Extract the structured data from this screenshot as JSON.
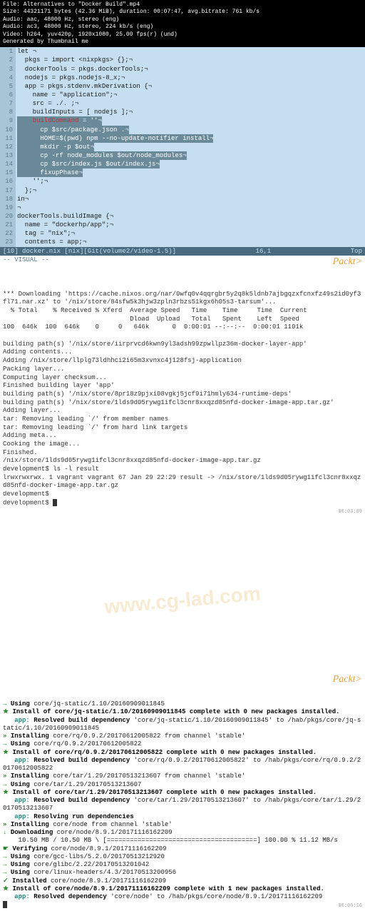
{
  "video_meta": {
    "line1": "File: Alternatives to \"Docker Build\".mp4",
    "line2": "Size: 44321171 bytes (42.36 MiB), duration: 00:07:47, avg.bitrate: 761 kb/s",
    "line3": "Audio: aac, 48000 Hz, stereo (eng)",
    "line4": "Audio: ac3, 48000 Hz, stereo, 224 kb/s (eng)",
    "line5": "Video: h264, yuv420p, 1920x1080, 25.00 fps(r) (und)",
    "line6": "Generated by Thumbnail me"
  },
  "editor": {
    "lines": [
      {
        "n": "1",
        "t": "let ¬"
      },
      {
        "n": "2",
        "t": "  pkgs = import <nixpkgs> {};¬"
      },
      {
        "n": "3",
        "t": "  dockerTools = pkgs.dockerTools;¬"
      },
      {
        "n": "4",
        "t": "  nodejs = pkgs.nodejs-8_x;¬"
      },
      {
        "n": "5",
        "t": "  app = pkgs.stdenv.mkDerivation {¬"
      },
      {
        "n": "6",
        "t": "    name = \"application\";¬"
      },
      {
        "n": "7",
        "t": "    src = ./. ;¬"
      },
      {
        "n": "8",
        "t": "    buildInputs = [ nodejs ];¬"
      },
      {
        "n": "9",
        "t": "    buildCommand = ''¬",
        "sel": true,
        "red": "buildCommand"
      },
      {
        "n": "10",
        "t": "      cp $src/package.json .¬",
        "sel": true
      },
      {
        "n": "11",
        "t": "      HOME=$(pwd) npm --no-update-notifier install¬",
        "sel": true
      },
      {
        "n": "12",
        "t": "      mkdir -p $out¬",
        "sel": true
      },
      {
        "n": "13",
        "t": "      cp -rf node_modules $out/node_modules¬",
        "sel": true
      },
      {
        "n": "14",
        "t": "      cp $src/index.js $out/index.js¬",
        "sel": true
      },
      {
        "n": "15",
        "t": "      fixupPhase¬",
        "sel": true
      },
      {
        "n": "16",
        "t": "    '';¬"
      },
      {
        "n": "17",
        "t": "  };¬"
      },
      {
        "n": "18",
        "t": "in¬"
      },
      {
        "n": "19",
        "t": "¬"
      },
      {
        "n": "20",
        "t": "dockerTools.buildImage {¬"
      },
      {
        "n": "21",
        "t": "  name = \"dockerhp/app\";¬"
      },
      {
        "n": "22",
        "t": "  tag = \"nix\";¬"
      },
      {
        "n": "23",
        "t": "  contents = app;¬"
      }
    ],
    "statusbar_left": "[10] docker.nix [nix][Git(volume2/video-1.5)]",
    "statusbar_mid": "16,1",
    "statusbar_right": "Top",
    "mode": "-- VISUAL --"
  },
  "terminal1": {
    "packt": "Packt>",
    "lines": [
      "",
      "*** Downloading 'https://cache.nixos.org/nar/0wfq0v4qqrgbr5y2q8k5ldnb7ajbgqzxfcnxfz49s2id0yf3fl71.nar.xz' to '/nix/store/84sfw5k3hjw3zpln3rbzs51kgx6h05s3-tarsum'...",
      "  % Total    % Received % Xferd  Average Speed   Time    Time     Time  Current",
      "                                 Dload  Upload   Total   Spent    Left  Speed",
      "100  646k  100  646k    0     0   646k      0  0:00:01 --:--:--  0:00:01 1101k",
      "",
      "building path(s) '/nix/store/iirprvcd6kwn9yl3adsh99zpwllpz36m-docker-layer-app'",
      "Adding contents...",
      "Adding /nix/store/llplg73ldhhci2i65m3xvnxc4j128fsj-application",
      "Packing layer...",
      "Computing layer checksum...",
      "Finished building layer 'app'",
      "building path(s) '/nix/store/8pr18z9pjxi08vgkj5jcf9i71hmly634-runtime-deps'",
      "building path(s) '/nix/store/1lds9d05rywg1ifcl3cnr8xxqzd85nfd-docker-image-app.tar.gz'",
      "Adding layer...",
      "tar: Removing leading `/' from member names",
      "tar: Removing leading `/' from hard link targets",
      "Adding meta...",
      "Cooking the image...",
      "Finished.",
      "/nix/store/1lds9d05rywg1ifcl3cnr8xxqzd85nfd-docker-image-app.tar.gz",
      "development$ ls -l result",
      "lrwxrwxrwx. 1 vagrant vagrant 67 Jan 29 22:29 result -> /nix/store/1lds9d05rywg1ifcl3cnr8xxqzd85nfd-docker-image-app.tar.gz",
      "development$ ",
      "development$ "
    ],
    "timestamp": "00:03:09"
  },
  "watermark": "www.cg-lad.com",
  "hab": {
    "packt": "Packt>",
    "lines": [
      {
        "p": "→ ",
        "a": "Using",
        "t": " core/jq-static/1.10/20160909011845"
      },
      {
        "p": "★ ",
        "a": "Install of core/jq-static/1.10/20160909011845 complete with 0 new packages installed.",
        "t": ""
      },
      {
        "p": "   ",
        "app": "app:",
        "a": " Resolved build dependency",
        "t": " 'core/jq-static/1.10/20160909011845' to /hab/pkgs/core/jq-static/1.10/20160909011845"
      },
      {
        "p": "» ",
        "a": "Installing",
        "t": " core/rq/0.9.2/20170612005822 from channel 'stable'"
      },
      {
        "p": "→ ",
        "a": "Using",
        "t": " core/rq/0.9.2/20170612005822"
      },
      {
        "p": "★ ",
        "a": "Install of core/rq/0.9.2/20170612005822 complete with 0 new packages installed.",
        "t": ""
      },
      {
        "p": "   ",
        "app": "app:",
        "a": " Resolved build dependency",
        "t": " 'core/rq/0.9.2/20170612005822' to /hab/pkgs/core/rq/0.9.2/20170612005822"
      },
      {
        "p": "» ",
        "a": "Installing",
        "t": " core/tar/1.29/20170513213607 from channel 'stable'"
      },
      {
        "p": "→ ",
        "a": "Using",
        "t": " core/tar/1.29/20170513213607"
      },
      {
        "p": "★ ",
        "a": "Install of core/tar/1.29/20170513213607 complete with 0 new packages installed.",
        "t": ""
      },
      {
        "p": "   ",
        "app": "app:",
        "a": " Resolved build dependency",
        "t": " 'core/tar/1.29/20170513213607' to /hab/pkgs/core/tar/1.29/20170513213607"
      },
      {
        "p": "   ",
        "app": "app:",
        "a": " Resolving run dependencies",
        "t": ""
      },
      {
        "p": "» ",
        "a": "Installing",
        "t": " core/node from channel 'stable'"
      },
      {
        "p": "↓ ",
        "a": "Downloading",
        "t": " core/node/8.9.1/20171116162209"
      },
      {
        "p": "    ",
        "a": "",
        "t": "10.50 MB / 10.50 MB \\ [=======================================] 100.00 % 11.12 MB/s"
      },
      {
        "p": "☛ ",
        "a": "Verifying",
        "t": " core/node/8.9.1/20171116162209"
      },
      {
        "p": "→ ",
        "a": "Using",
        "t": " core/gcc-libs/5.2.0/20170513212920"
      },
      {
        "p": "→ ",
        "a": "Using",
        "t": " core/glibc/2.22/20170513201042"
      },
      {
        "p": "→ ",
        "a": "Using",
        "t": " core/linux-headers/4.3/20170513200956"
      },
      {
        "p": "✓ ",
        "a": "Installed",
        "t": " core/node/8.9.1/20171116162209"
      },
      {
        "p": "★ ",
        "a": "Install of core/node/8.9.1/20171116162209 complete with 1 new packages installed.",
        "t": ""
      },
      {
        "p": "   ",
        "app": "app:",
        "a": " Resolved dependency",
        "t": " 'core/node' to /hab/pkgs/core/node/8.9.1/20171116162209"
      }
    ],
    "timestamp": "00:06:16"
  }
}
